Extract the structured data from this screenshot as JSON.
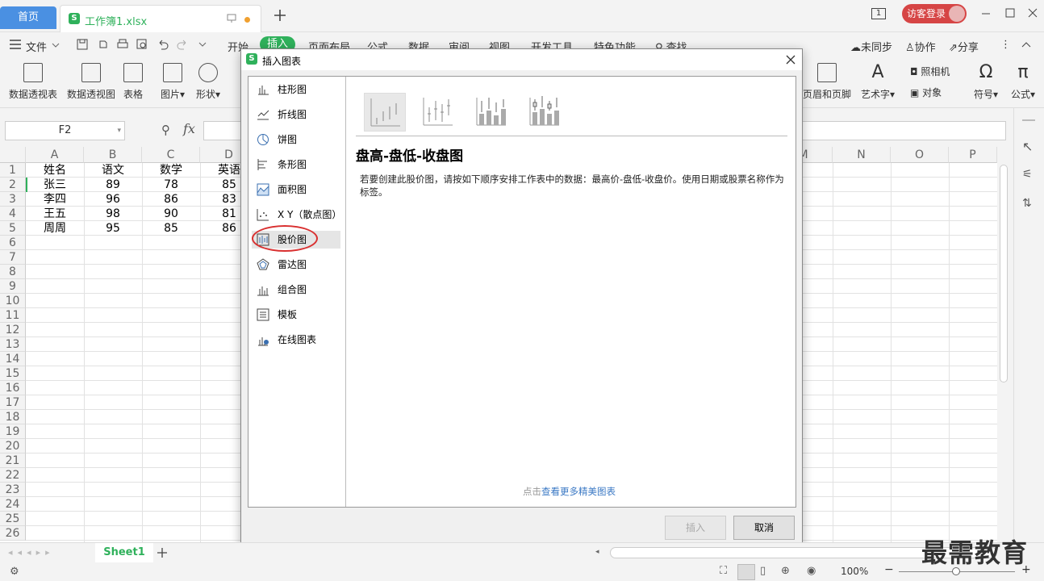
{
  "tabs": {
    "home": "首页",
    "file": "工作簿1.xlsx"
  },
  "titlebar": {
    "badge": "1",
    "login": "访客登录"
  },
  "menu": {
    "file": "文件",
    "items": [
      "开始",
      "插入",
      "页面布局",
      "公式",
      "数据",
      "审阅",
      "视图",
      "开发工具",
      "特色功能"
    ],
    "active": "插入",
    "search": "查找",
    "unsynced": "未同步",
    "collab": "协作",
    "share": "分享"
  },
  "ribbon": {
    "pivot_table": "数据透视表",
    "pivot_chart": "数据透视图",
    "table": "表格",
    "picture": "图片",
    "shape": "形状",
    "header_footer": "页眉和页脚",
    "art_text": "艺术字",
    "camera": "照相机",
    "object": "对象",
    "symbol": "符号",
    "formula": "公式"
  },
  "formula_bar": {
    "name_box": "F2",
    "fx": "fx"
  },
  "sheet": {
    "columns": [
      "A",
      "B",
      "C",
      "D",
      "M",
      "N",
      "O",
      "P"
    ],
    "rows": [
      "1",
      "2",
      "3",
      "4",
      "5",
      "6",
      "7",
      "8",
      "9",
      "10",
      "11",
      "12",
      "13",
      "14",
      "15",
      "16",
      "17",
      "18",
      "19",
      "20",
      "21",
      "22",
      "23",
      "24",
      "25",
      "26"
    ],
    "data": [
      [
        "姓名",
        "语文",
        "数学",
        "英语"
      ],
      [
        "张三",
        "89",
        "78",
        "85"
      ],
      [
        "李四",
        "96",
        "86",
        "83"
      ],
      [
        "王五",
        "98",
        "90",
        "81"
      ],
      [
        "周周",
        "95",
        "85",
        "86"
      ]
    ],
    "tab": "Sheet1"
  },
  "dialog": {
    "title": "插入图表",
    "categories": [
      "柱形图",
      "折线图",
      "饼图",
      "条形图",
      "面积图",
      "X Y（散点图）",
      "股价图",
      "雷达图",
      "组合图",
      "模板",
      "在线图表"
    ],
    "selected": "股价图",
    "subtype_title": "盘高-盘低-收盘图",
    "description": "若要创建此股价图，请按如下顺序安排工作表中的数据：最高价-盘低-收盘价。使用日期或股票名称作为标签。",
    "more_prefix": "点击",
    "more_link": "查看更多精美图表",
    "insert_btn": "插入",
    "cancel_btn": "取消"
  },
  "status": {
    "zoom": "100%"
  },
  "watermark": "最需教育",
  "colors": {
    "accent_green": "#2fb15b",
    "home_tab": "#4a90e2",
    "login_red": "#d64545",
    "highlight_red": "#d93030"
  }
}
